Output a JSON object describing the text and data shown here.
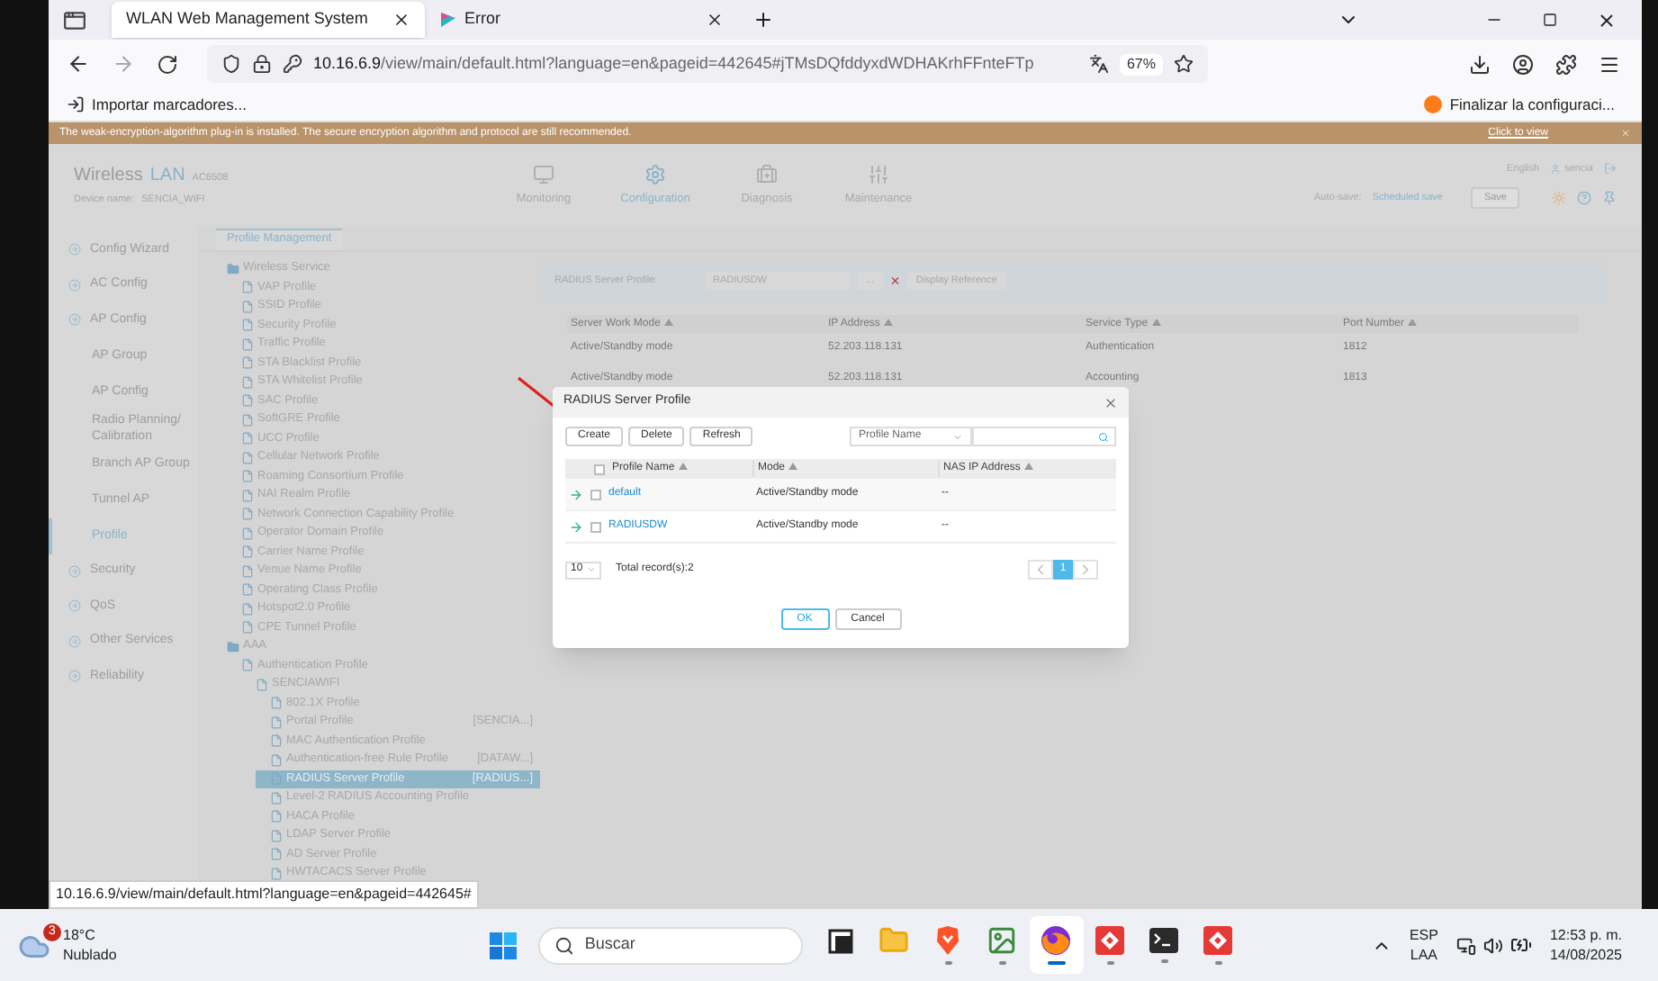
{
  "browser": {
    "tabs": [
      {
        "title": "WLAN Web Management System",
        "selected": true,
        "kind": "plain"
      },
      {
        "title": "Error",
        "selected": false,
        "kind": "wing"
      }
    ],
    "url": {
      "host": "10.16.6.9",
      "path": "/view/main/default.html?language=en&pageid=442645#jTMsDQfddyxdWDHAKrhFFnteFTp"
    },
    "zoom": "67%",
    "bookmarks": {
      "left": "Importar marcadores...",
      "right": "Finalizar la configuraci..."
    }
  },
  "page": {
    "banner": {
      "text": "The weak-encryption-algorithm plug-in is installed. The secure encryption algorithm and protocol are still recommended.",
      "link": "Click to view"
    },
    "header": {
      "brand": "Wireless",
      "brand_accent": "LAN",
      "model": "AC6508",
      "device_label": "Device name:",
      "device_name": "SENCIA_WIFI",
      "nav": [
        {
          "label": "Monitoring",
          "kind": "monitor",
          "selected": false
        },
        {
          "label": "Configuration",
          "kind": "gear",
          "selected": true
        },
        {
          "label": "Diagnosis",
          "kind": "kit",
          "selected": false
        },
        {
          "label": "Maintenance",
          "kind": "sliders",
          "selected": false
        }
      ],
      "language": "English",
      "user": "sencia",
      "autosave_label": "Auto-save:",
      "autosave_value": "Scheduled save",
      "save": "Save"
    },
    "sidebar": {
      "items": [
        {
          "label": "Config Wizard",
          "selected": false
        },
        {
          "label": "AC Config",
          "selected": false
        },
        {
          "label": "AP Config",
          "selected": false,
          "children": [
            {
              "label": "AP Group",
              "selected": false
            },
            {
              "label": "AP Config",
              "selected": false
            },
            {
              "label": "Radio Planning/ Calibration",
              "selected": false
            },
            {
              "label": "Branch AP Group",
              "selected": false
            },
            {
              "label": "Tunnel AP",
              "selected": false
            },
            {
              "label": "Profile",
              "selected": true
            }
          ]
        },
        {
          "label": "Security",
          "selected": false
        },
        {
          "label": "QoS",
          "selected": false
        },
        {
          "label": "Other Services",
          "selected": false
        },
        {
          "label": "Reliability",
          "selected": false
        }
      ]
    },
    "subtab": "Profile Management",
    "tree": [
      {
        "label": "Wireless Service",
        "kind": "folder",
        "selected": false,
        "children": [
          {
            "label": "VAP Profile",
            "kind": "file",
            "selected": false
          },
          {
            "label": "SSID Profile",
            "kind": "file",
            "selected": false
          },
          {
            "label": "Security Profile",
            "kind": "file",
            "selected": false
          },
          {
            "label": "Traffic Profile",
            "kind": "file",
            "selected": false
          },
          {
            "label": "STA Blacklist Profile",
            "kind": "file",
            "selected": false
          },
          {
            "label": "STA Whitelist Profile",
            "kind": "file",
            "selected": false
          },
          {
            "label": "SAC Profile",
            "kind": "file",
            "selected": false
          },
          {
            "label": "SoftGRE Profile",
            "kind": "file",
            "selected": false
          },
          {
            "label": "UCC Profile",
            "kind": "file",
            "selected": false
          },
          {
            "label": "Cellular Network Profile",
            "kind": "file",
            "selected": false
          },
          {
            "label": "Roaming Consortium Profile",
            "kind": "file",
            "selected": false
          },
          {
            "label": "NAI Realm Profile",
            "kind": "file",
            "selected": false
          },
          {
            "label": "Network Connection Capability Profile",
            "kind": "file",
            "selected": false
          },
          {
            "label": "Operator Domain Profile",
            "kind": "file",
            "selected": false
          },
          {
            "label": "Carrier Name Profile",
            "kind": "file",
            "selected": false
          },
          {
            "label": "Venue Name Profile",
            "kind": "file",
            "selected": false
          },
          {
            "label": "Operating Class Profile",
            "kind": "file",
            "selected": false
          },
          {
            "label": "Hotspot2.0 Profile",
            "kind": "file",
            "selected": false
          },
          {
            "label": "CPE Tunnel Profile",
            "kind": "file",
            "selected": false
          }
        ]
      },
      {
        "label": "AAA",
        "kind": "folder",
        "selected": false,
        "children": [
          {
            "label": "Authentication Profile",
            "kind": "file",
            "selected": false,
            "children": [
              {
                "label": "SENCIAWIFI",
                "kind": "file",
                "selected": false,
                "children": [
                  {
                    "label": "802.1X Profile",
                    "kind": "file",
                    "selected": false
                  },
                  {
                    "label": "Portal Profile",
                    "kind": "file",
                    "selected": false,
                    "note": "[SENCIA...]"
                  },
                  {
                    "label": "MAC Authentication Profile",
                    "kind": "file",
                    "selected": false
                  },
                  {
                    "label": "Authentication-free Rule Profile",
                    "kind": "file",
                    "selected": false,
                    "note": "[DATAW...]"
                  },
                  {
                    "label": "RADIUS Server Profile",
                    "kind": "file",
                    "selected": true,
                    "note": "[RADIUS...]"
                  },
                  {
                    "label": "Level-2 RADIUS Accounting Profile",
                    "kind": "file",
                    "selected": false
                  },
                  {
                    "label": "HACA Profile",
                    "kind": "file",
                    "selected": false
                  },
                  {
                    "label": "LDAP Server Profile",
                    "kind": "file",
                    "selected": false
                  },
                  {
                    "label": "AD Server Profile",
                    "kind": "file",
                    "selected": false
                  },
                  {
                    "label": "HWTACACS Server Profile",
                    "kind": "file",
                    "selected": false
                  }
                ]
              }
            ]
          }
        ]
      }
    ],
    "profile_field": {
      "label": "RADIUS Server Profile:",
      "value": "RADIUSDW",
      "browse": "...",
      "clear": "×",
      "reference": "Display Reference"
    },
    "table": {
      "columns": [
        "Server Work Mode",
        "IP Address",
        "Service Type",
        "Port Number"
      ],
      "rows": [
        [
          "Active/Standby mode",
          "52.203.118.131",
          "Authentication",
          "1812"
        ],
        [
          "Active/Standby mode",
          "52.203.118.131",
          "Accounting",
          "1813"
        ]
      ]
    },
    "status_link": "10.16.6.9/view/main/default.html?language=en&pageid=442645#"
  },
  "dialog": {
    "title": "RADIUS Server Profile",
    "toolbar": [
      "Create",
      "Delete",
      "Refresh"
    ],
    "filter": {
      "value": "Profile Name"
    },
    "columns": [
      "Profile Name",
      "Mode",
      "NAS IP Address"
    ],
    "select_all_checked": false,
    "rows": [
      {
        "name": "default",
        "mode": "Active/Standby mode",
        "nas_ip": "--",
        "checked": false
      },
      {
        "name": "RADIUSDW",
        "mode": "Active/Standby mode",
        "nas_ip": "--",
        "checked": false
      }
    ],
    "page_size": "10",
    "total": "Total record(s):2",
    "pages": [
      {
        "label": "1",
        "selected": true
      }
    ],
    "ok": "OK",
    "cancel": "Cancel"
  },
  "taskbar": {
    "weather": {
      "badge": "3",
      "temp": "18°C",
      "condition": "Nublado"
    },
    "search": "Buscar",
    "apps": [
      {
        "kind": "taskview",
        "active": false,
        "running": false
      },
      {
        "kind": "folder",
        "active": false,
        "running": false
      },
      {
        "kind": "shield",
        "active": false,
        "running": true
      },
      {
        "kind": "image",
        "active": false,
        "running": true
      },
      {
        "kind": "globe",
        "active": true,
        "running": true
      },
      {
        "kind": "diamond",
        "active": false,
        "running": true
      },
      {
        "kind": "terminal",
        "active": false,
        "running": true
      },
      {
        "kind": "diamond",
        "active": false,
        "running": true
      }
    ],
    "lang": "ESP",
    "layout": "LAA",
    "time": "12:53 p. m.",
    "date": "14/08/2025"
  }
}
